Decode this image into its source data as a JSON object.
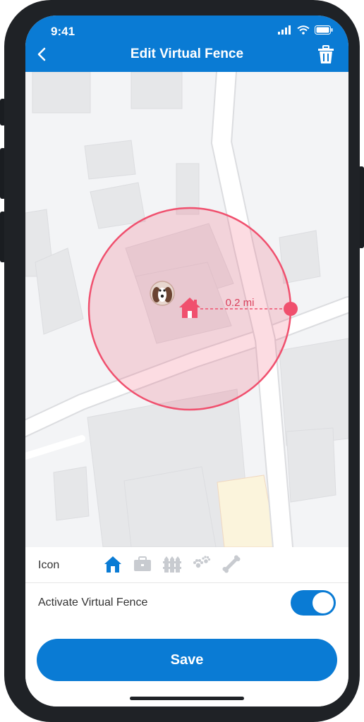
{
  "status_bar": {
    "time": "9:41"
  },
  "header": {
    "title": "Edit Virtual Fence",
    "back_icon": "chevron-left-icon",
    "delete_icon": "trash-icon"
  },
  "map": {
    "fence_radius_label": "0.2 mi",
    "fence_color": "#f0506e"
  },
  "icon_picker": {
    "label": "Icon",
    "options": [
      {
        "icon": "home-icon",
        "selected": true
      },
      {
        "icon": "briefcase-icon",
        "selected": false
      },
      {
        "icon": "fence-icon",
        "selected": false
      },
      {
        "icon": "paw-icon",
        "selected": false
      },
      {
        "icon": "bone-icon",
        "selected": false
      }
    ]
  },
  "activate": {
    "label": "Activate Virtual Fence",
    "enabled": true
  },
  "save_label": "Save",
  "colors": {
    "accent": "#0a7bd4",
    "fence": "#f0506e"
  }
}
